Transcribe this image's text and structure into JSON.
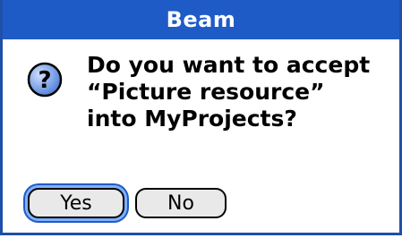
{
  "dialog": {
    "title": "Beam",
    "message_lines": [
      "Do you want to accept",
      "“Picture resource”",
      "into MyProjects?"
    ],
    "icon": "question-icon"
  },
  "buttons": {
    "yes_label": "Yes",
    "no_label": "No"
  },
  "colors": {
    "title_bar": "#1f5bc6",
    "focus_ring": "#7fb0ff"
  }
}
